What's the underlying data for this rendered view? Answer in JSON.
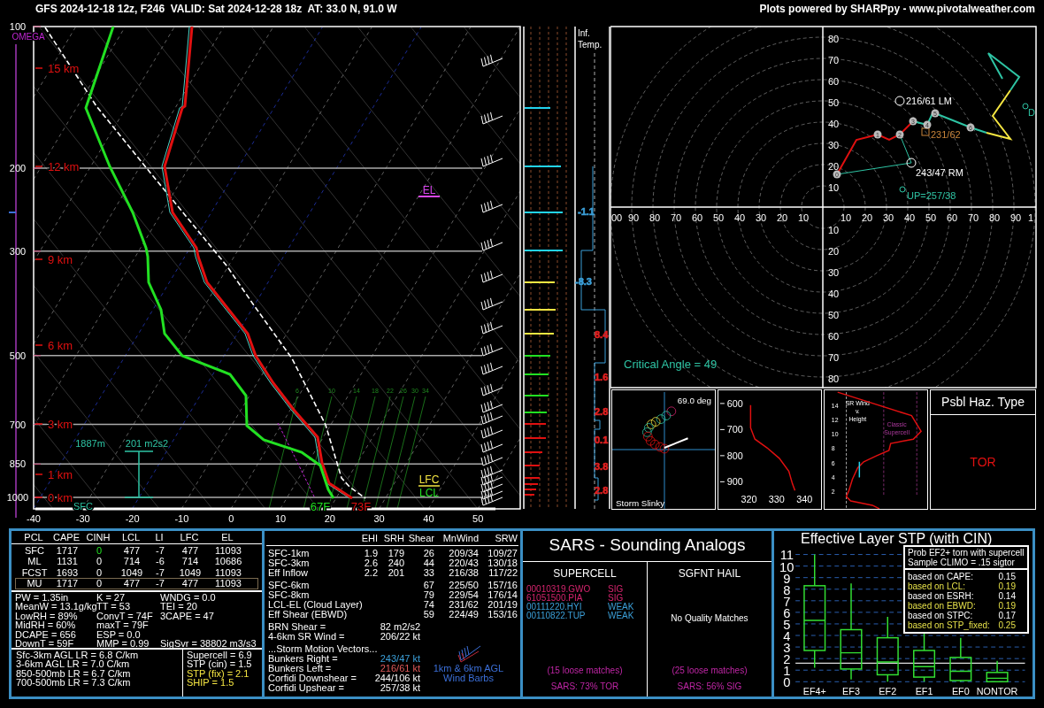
{
  "header": {
    "title": "GFS 2024-12-18 12z, F246  VALID: Sat 2024-12-28 18z  AT: 33.0 N, 91.0 W",
    "credit": "Plots powered by SHARPpy - www.pivotalweather.com"
  },
  "skewt": {
    "omega_label": "OMEGA",
    "pressure_labels": [
      "100",
      "200",
      "300",
      "500",
      "700",
      "850",
      "1000"
    ],
    "height_labels": [
      "15 km",
      "12 km",
      "9 km",
      "6 km",
      "3 km",
      "1 km",
      "0 km"
    ],
    "temp_labels": [
      "-40",
      "-30",
      "-20",
      "-10",
      "0",
      "10",
      "20",
      "30",
      "40",
      "50"
    ],
    "mixing_ratio_labels": [
      "6",
      "10",
      "14",
      "18",
      "22",
      "26",
      "30",
      "34"
    ],
    "el_label": "EL",
    "lfc_label": "LFC",
    "lcl_label": "LCL",
    "sfc_label": "SFC",
    "dewpoint_label": "67F",
    "temperature_label": "73F",
    "eff_inflow_depth": "1887m",
    "eff_inflow_srh": "201 m2s2"
  },
  "inferred_temp": {
    "title": [
      "Inf.",
      "Temp."
    ],
    "values": [
      {
        "text": "-1.1",
        "color": "#3b9fd8"
      },
      {
        "text": "-8.3",
        "color": "#3b9fd8"
      },
      {
        "text": "8.4",
        "color": "#e02020"
      },
      {
        "text": "1.6",
        "color": "#e02020"
      },
      {
        "text": "2.8",
        "color": "#e02020"
      },
      {
        "text": "0.1",
        "color": "#e02020"
      },
      {
        "text": "3.8",
        "color": "#e02020"
      },
      {
        "text": "2.8",
        "color": "#e02020"
      }
    ]
  },
  "hodograph": {
    "up_labels": [
      "80",
      "70",
      "60",
      "50",
      "40",
      "30",
      "20",
      "10"
    ],
    "down_labels": [
      "10",
      "20",
      "30",
      "40",
      "50",
      "60",
      "70",
      "80"
    ],
    "left_labels": [
      "00",
      "90",
      "80",
      "70",
      "60",
      "50",
      "40",
      "30",
      "20",
      "10"
    ],
    "right_labels": [
      "10",
      "20",
      "30",
      "40",
      "50",
      "60",
      "70",
      "80",
      "90",
      "1"
    ],
    "markers": [
      "0",
      "1",
      "2",
      "3",
      "4",
      "5",
      "6"
    ],
    "lm": "216/61 LM",
    "mean": "231/62",
    "rm": "243/47 RM",
    "up": "UP=257/38",
    "dn": "D",
    "critical_angle": "Critical Angle = 49"
  },
  "slinky": {
    "angle": "69.0 deg",
    "title": "Storm Slinky"
  },
  "theta_e": {
    "pressure_labels": [
      "600",
      "700",
      "800",
      "900"
    ],
    "theta_labels": [
      "320",
      "330",
      "340"
    ]
  },
  "sr_wind": {
    "height_labels": [
      "14",
      "12",
      "10",
      "8",
      "6",
      "4",
      "2"
    ],
    "title": [
      "SR Wind",
      "v.",
      "Height"
    ],
    "band_label": [
      "Classic",
      "Supercell"
    ]
  },
  "hazard": {
    "title": "Psbl Haz. Type",
    "type": "TOR"
  },
  "parcels": {
    "columns": [
      "PCL",
      "CAPE",
      "CINH",
      "LCL",
      "LI",
      "LFC",
      "EL"
    ],
    "rows": [
      {
        "cells": [
          "SFC",
          "1717",
          "0",
          "477",
          "-7",
          "477",
          "11093"
        ],
        "cinh_highlight": true,
        "selected": false
      },
      {
        "cells": [
          "ML",
          "1131",
          "0",
          "714",
          "-6",
          "714",
          "10686"
        ],
        "cinh_highlight": false,
        "selected": false
      },
      {
        "cells": [
          "FCST",
          "1693",
          "0",
          "1049",
          "-7",
          "1049",
          "11093"
        ],
        "cinh_highlight": false,
        "selected": false
      },
      {
        "cells": [
          "MU",
          "1717",
          "0",
          "477",
          "-7",
          "477",
          "11093"
        ],
        "cinh_highlight": false,
        "selected": true
      }
    ]
  },
  "indices": [
    [
      "PW = 1.35in",
      "MeanW = 13.1g/kg",
      "LowRH = 89%",
      "MidRH = 60%",
      "DCAPE = 656",
      "DownT = 59F"
    ],
    [
      "K = 27",
      "TT = 53",
      "ConvT = 74F",
      "maxT = 79F",
      "ESP = 0.0",
      "MMP = 0.99"
    ],
    [
      "WNDG = 0.0",
      "TEI = 20",
      "3CAPE = 47",
      "SigSvr = 38802 m3/s3"
    ]
  ],
  "lapse_rates": [
    "Sfc-3km AGL LR = 6.8 C/km",
    "3-6km AGL LR = 7.0 C/km",
    "850-500mb LR = 6.7 C/km",
    "700-500mb LR = 7.3 C/km"
  ],
  "supercell": [
    {
      "text": "Supercell = 6.9",
      "highlight": false
    },
    {
      "text": "STP (cin) = 1.5",
      "highlight": false
    },
    {
      "text": "STP (fix) = 2.1",
      "highlight": true
    },
    {
      "text": "SHIP = 1.5",
      "highlight": true
    }
  ],
  "kinematics": {
    "columns": [
      "EHI",
      "SRH",
      "Shear",
      "MnWind",
      "SRW"
    ],
    "groups": [
      [
        {
          "cells": [
            "SFC-1km",
            "1.9",
            "179",
            "26",
            "209/34",
            "109/27"
          ]
        },
        {
          "cells": [
            "SFC-3km",
            "2.6",
            "240",
            "44",
            "220/43",
            "130/18"
          ]
        },
        {
          "cells": [
            "Eff Inflow",
            "2.2",
            "201",
            "33",
            "216/38",
            "117/22"
          ]
        }
      ],
      [
        {
          "cells": [
            "SFC-6km",
            "",
            "",
            "67",
            "225/50",
            "157/16"
          ]
        },
        {
          "cells": [
            "SFC-8km",
            "",
            "",
            "79",
            "229/54",
            "176/14"
          ]
        },
        {
          "cells": [
            "LCL-EL (Cloud Layer)",
            "",
            "",
            "74",
            "231/62",
            "201/19"
          ]
        },
        {
          "cells": [
            "Eff Shear (EBWD)",
            "",
            "",
            "59",
            "224/49",
            "153/16"
          ]
        }
      ]
    ]
  },
  "brn": [
    {
      "label": "BRN Shear =",
      "value": "82 m2/s2"
    },
    {
      "label": "4-6km SR Wind =",
      "value": "206/22 kt"
    }
  ],
  "storm_motion": {
    "title": "...Storm Motion Vectors...",
    "rows": [
      {
        "label": "Bunkers Right =",
        "value": "243/47 kt",
        "color": "#3b9fd8"
      },
      {
        "label": "Bunkers Left =",
        "value": "216/61 kt",
        "color": "#e05a5a"
      },
      {
        "label": "Corfidi Downshear =",
        "value": "244/106 kt",
        "color": "#ffffff"
      },
      {
        "label": "Corfidi Upshear =",
        "value": "257/38 kt",
        "color": "#ffffff"
      }
    ]
  },
  "barb_caption": [
    "1km & 6km AGL",
    "Wind Barbs"
  ],
  "sars": {
    "title": "SARS - Sounding Analogs",
    "supercell": {
      "title": "SUPERCELL",
      "matches": [
        {
          "id": "00010319.GWO",
          "class": "SIG",
          "color": "#d6246e"
        },
        {
          "id": "61051500.PIA",
          "class": "SIG",
          "color": "#d6246e"
        },
        {
          "id": "00111220.HYI",
          "class": "WEAK",
          "color": "#3b9fd8"
        },
        {
          "id": "00110822.TUP",
          "class": "WEAK",
          "color": "#3b9fd8"
        }
      ],
      "loose": "(15 loose matches)",
      "summary": "SARS: 73% TOR"
    },
    "hail": {
      "title": "SGFNT HAIL",
      "none": "No Quality Matches",
      "loose": "(25 loose matches)",
      "summary": "SARS: 56% SIG"
    }
  },
  "stp": {
    "title": "Effective Layer STP (with CIN)",
    "y_labels": [
      "11",
      "10",
      "9",
      "8",
      "7",
      "6",
      "5",
      "4",
      "3",
      "2",
      "1",
      "0"
    ],
    "categories": [
      "EF4+",
      "EF3",
      "EF2",
      "EF1",
      "EF0",
      "NONTOR"
    ],
    "legend": {
      "header": [
        "Prob EF2+ torn with supercell",
        "Sample CLIMO = .15 sigtor"
      ],
      "rows": [
        {
          "label": "based on CAPE:",
          "value": "0.15",
          "highlight": false
        },
        {
          "label": "based on LCL:",
          "value": "0.19",
          "highlight": true
        },
        {
          "label": "based on ESRH:",
          "value": "0.14",
          "highlight": false
        },
        {
          "label": "based on EBWD:",
          "value": "0.19",
          "highlight": true
        },
        {
          "label": "based on STPC:",
          "value": "0.17",
          "highlight": false
        },
        {
          "label": "based on STP_fixed:",
          "value": "0.25",
          "highlight": true
        }
      ]
    }
  }
}
